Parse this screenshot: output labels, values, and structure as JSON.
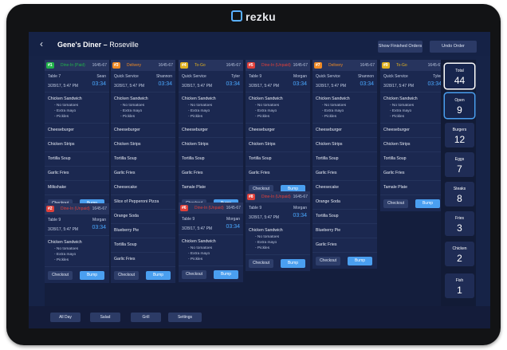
{
  "brand": "rezku",
  "header": {
    "back_icon": "chevron-left-icon",
    "restaurant": "Gene's Diner",
    "separator": " – ",
    "location": "Roseville",
    "show_finished": "Show Finished Orders",
    "undo": "Undo Order"
  },
  "colors": {
    "dine_in_paid": "#21b34a",
    "dine_in_unpaid": "#e0403a",
    "delivery": "#f08a24",
    "to_go": "#e0b020",
    "elapsed": "#4aa8ff"
  },
  "actions": {
    "checkout": "Checkout",
    "bump": "Bump"
  },
  "orders": {
    "o1": {
      "num": "#1",
      "type": "Dine-In (Paid)",
      "id": "1645-67",
      "table": "Table 7",
      "server": "Sean",
      "time": "3/28/17, 5:47 PM",
      "elapsed": "03:34",
      "items": [
        "Chicken Sandwich",
        "Cheeseburger",
        "Chicken Strips",
        "Tortilla Soup",
        "Garlic Fries",
        "Milkshake"
      ],
      "mods": [
        "- No tomatoes",
        "- Extra mayo",
        "- Pickles"
      ]
    },
    "o2": {
      "num": "#2",
      "type": "Dine-In (Unpaid)",
      "id": "1645-67",
      "table": "Table 9",
      "server": "Morgan",
      "time": "3/28/17, 5:47 PM",
      "elapsed": "03:34",
      "items": [
        "Chicken Sandwich"
      ],
      "mods": [
        "- No tomatoes",
        "- Extra mayo",
        "- Pickles"
      ]
    },
    "o3": {
      "num": "#3",
      "type": "Delivery",
      "id": "1645-67",
      "table": "Quick Service",
      "server": "Shannon",
      "time": "3/28/17, 5:47 PM",
      "elapsed": "03:34",
      "items": [
        "Chicken Sandwich",
        "Cheeseburger",
        "Chicken Strips",
        "Tortilla Soup",
        "Garlic Fries",
        "Cheesecake",
        "Slice of Pepperoni Pizza",
        "Orange Soda",
        "Blueberry Pie",
        "Tortilla Soup",
        "Garlic Fries"
      ],
      "mods": [
        "- No tomatoes",
        "- Extra mayo",
        "- Pickles"
      ]
    },
    "o4": {
      "num": "#4",
      "type": "To-Go",
      "id": "1645-67",
      "table": "Quick Service",
      "server": "Tyler",
      "time": "3/28/17, 5:47 PM",
      "elapsed": "03:34",
      "items": [
        "Chicken Sandwich",
        "Cheeseburger",
        "Chicken Strips",
        "Tortilla Soup",
        "Garlic Fries",
        "Tamale Plate"
      ],
      "mods": [
        "- No tomatoes",
        "- Extra mayo",
        "- Pickles"
      ]
    },
    "o6": {
      "num": "#6",
      "type": "Dine-In (Unpaid)",
      "id": "1645-67",
      "table": "Table 9",
      "server": "Morgan",
      "time": "3/28/17, 5:47 PM",
      "elapsed": "03:34",
      "items": [
        "Chicken Sandwich"
      ],
      "mods": [
        "- No tomatoes",
        "- Extra mayo",
        "- Pickles"
      ]
    },
    "o5": {
      "num": "#5",
      "type": "Dine-In (Unpaid)",
      "id": "1645-67",
      "table": "Table 9",
      "server": "Morgan",
      "time": "3/28/17, 5:47 PM",
      "elapsed": "03:34",
      "items": [
        "Chicken Sandwich",
        "Cheeseburger",
        "Chicken Strips",
        "Tortilla Soup",
        "Garlic Fries"
      ],
      "mods": [
        "- No tomatoes",
        "- Extra mayo",
        "- Pickles"
      ]
    },
    "o8": {
      "num": "#8",
      "type": "Dine-In (Unpaid)",
      "id": "1645-67",
      "table": "Table 9",
      "server": "Morgan",
      "time": "3/28/17, 5:47 PM",
      "elapsed": "03:34",
      "items": [
        "Chicken Sandwich"
      ],
      "mods": [
        "- No tomatoes",
        "- Extra mayo",
        "- Pickles"
      ]
    },
    "o7": {
      "num": "#7",
      "type": "Delivery",
      "id": "1645-67",
      "table": "Quick Service",
      "server": "Shannon",
      "time": "3/28/17, 5:47 PM",
      "elapsed": "03:34",
      "items": [
        "Chicken Sandwich",
        "Cheeseburger",
        "Chicken Strips",
        "Tortilla Soup",
        "Garlic Fries",
        "Cheesecake",
        "Orange Soda",
        "Tortilla Soup",
        "Blueberry Pie",
        "Garlic Fries"
      ],
      "mods": [
        "- No tomatoes",
        "- Extra mayo",
        "- Pickles"
      ]
    },
    "o9": {
      "num": "#9",
      "type": "To-Go",
      "id": "1645-67",
      "table": "Quick Service",
      "server": "Tyler",
      "time": "3/28/17, 5:47 PM",
      "elapsed": "03:34",
      "items": [
        "Chicken Sandwich",
        "Cheeseburger",
        "Chicken Strips",
        "Tortilla Soup",
        "Garlic Fries",
        "Tamale Plate"
      ],
      "mods": [
        "- No tomatoes",
        "- Extra mayo",
        "- Pickles"
      ]
    }
  },
  "filters": [
    {
      "label": "Total",
      "count": "44"
    },
    {
      "label": "Open",
      "count": "9"
    },
    {
      "label": "Burgers",
      "count": "12"
    },
    {
      "label": "Eggs",
      "count": "7"
    },
    {
      "label": "Steaks",
      "count": "8"
    },
    {
      "label": "Fries",
      "count": "3"
    },
    {
      "label": "Chicken",
      "count": "2"
    },
    {
      "label": "Fish",
      "count": "1"
    }
  ],
  "stations": [
    "All Day",
    "Salad",
    "Grill",
    "Settings"
  ]
}
